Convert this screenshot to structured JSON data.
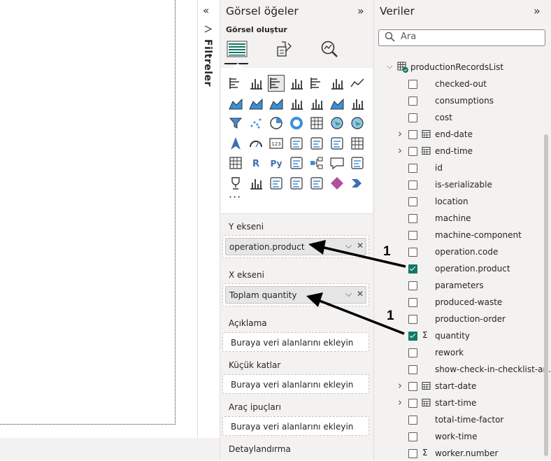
{
  "filters": {
    "label": "Filtreler"
  },
  "visuals": {
    "title": "Görsel öğeler",
    "build_label": "Görsel oluştur",
    "more": "···",
    "wells": [
      {
        "label": "Y ekseni",
        "field": "operation.product"
      },
      {
        "label": "X ekseni",
        "field": "Toplam quantity"
      },
      {
        "label": "Açıklama",
        "placeholder": "Buraya veri alanlarını ekleyin"
      },
      {
        "label": "Küçük katlar",
        "placeholder": "Buraya veri alanlarını ekleyin"
      },
      {
        "label": "Araç ipuçları",
        "placeholder": "Buraya veri alanlarını ekleyin"
      },
      {
        "label": "Detaylandırma"
      }
    ],
    "gallery_icons": [
      "stacked-bar-chart-icon",
      "stacked-column-chart-icon",
      "clustered-bar-chart-icon",
      "clustered-column-chart-icon",
      "100-stacked-bar-chart-icon",
      "100-stacked-column-chart-icon",
      "line-chart-icon",
      "area-chart-icon",
      "stacked-area-chart-icon",
      "100-stacked-area-chart-icon",
      "line-and-stacked-column-chart-icon",
      "line-and-clustered-column-chart-icon",
      "ribbon-chart-icon",
      "waterfall-chart-icon",
      "funnel-chart-icon",
      "scatter-chart-icon",
      "pie-chart-icon",
      "donut-chart-icon",
      "treemap-icon",
      "map-icon",
      "filled-map-icon",
      "azure-map-icon",
      "gauge-icon",
      "card-icon",
      "multi-row-card-icon",
      "kpi-icon",
      "slicer-icon",
      "table-icon",
      "matrix-icon",
      "r-visual-icon",
      "python-visual-icon",
      "key-influencers-icon",
      "decomposition-tree-icon",
      "qa-icon",
      "smart-narrative-icon",
      "metrics-icon",
      "paginated-report-icon",
      "power-apps-icon",
      "power-automate-icon",
      "arcgis-icon",
      "power-apps-diamond-icon",
      "power-automate-flow-icon"
    ]
  },
  "data": {
    "title": "Veriler",
    "search_placeholder": "Ara",
    "table_name": "productionRecordsList",
    "fields": [
      {
        "name": "checked-out",
        "checked": false,
        "type": ""
      },
      {
        "name": "consumptions",
        "checked": false,
        "type": ""
      },
      {
        "name": "cost",
        "checked": false,
        "type": ""
      },
      {
        "name": "end-date",
        "checked": false,
        "type": "date",
        "expandable": true
      },
      {
        "name": "end-time",
        "checked": false,
        "type": "date",
        "expandable": true
      },
      {
        "name": "id",
        "checked": false,
        "type": ""
      },
      {
        "name": "is-serializable",
        "checked": false,
        "type": ""
      },
      {
        "name": "location",
        "checked": false,
        "type": ""
      },
      {
        "name": "machine",
        "checked": false,
        "type": ""
      },
      {
        "name": "machine-component",
        "checked": false,
        "type": ""
      },
      {
        "name": "operation.code",
        "checked": false,
        "type": ""
      },
      {
        "name": "operation.product",
        "checked": true,
        "type": ""
      },
      {
        "name": "parameters",
        "checked": false,
        "type": ""
      },
      {
        "name": "produced-waste",
        "checked": false,
        "type": ""
      },
      {
        "name": "production-order",
        "checked": false,
        "type": ""
      },
      {
        "name": "quantity",
        "checked": true,
        "type": "sum"
      },
      {
        "name": "rework",
        "checked": false,
        "type": ""
      },
      {
        "name": "show-check-in-checklist-an...",
        "checked": false,
        "type": ""
      },
      {
        "name": "start-date",
        "checked": false,
        "type": "date",
        "expandable": true
      },
      {
        "name": "start-time",
        "checked": false,
        "type": "date",
        "expandable": true
      },
      {
        "name": "total-time-factor",
        "checked": false,
        "type": ""
      },
      {
        "name": "work-time",
        "checked": false,
        "type": ""
      },
      {
        "name": "worker.number",
        "checked": false,
        "type": "sum"
      }
    ]
  },
  "annotations": [
    {
      "label": "1"
    },
    {
      "label": "1"
    }
  ],
  "colors": {
    "accent": "#117865",
    "pane_bg": "#f3f2f1"
  }
}
